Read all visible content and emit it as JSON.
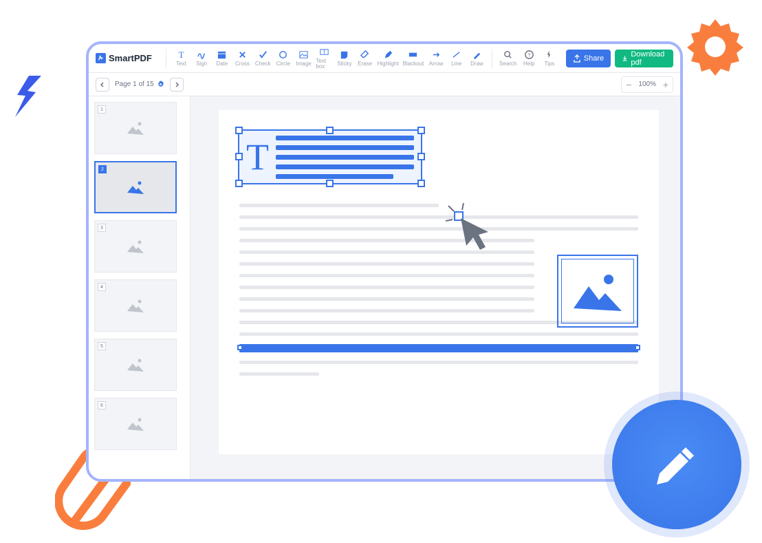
{
  "brand": "SmartPDF",
  "toolbar": {
    "tools": [
      "Text",
      "Sign",
      "Date",
      "Cross",
      "Check",
      "Circle",
      "Image",
      "Text box",
      "Sticky",
      "Erase",
      "Highlight",
      "Blackout",
      "Arrow",
      "Line",
      "Draw"
    ],
    "utils": [
      "Search",
      "Help",
      "Tips"
    ],
    "share": "Share",
    "download": "Download pdf"
  },
  "nav": {
    "page_info": "Page 1 of 15",
    "zoom": "100%"
  },
  "thumbs": [
    1,
    2,
    3,
    4,
    5,
    6
  ],
  "active_thumb": 2
}
